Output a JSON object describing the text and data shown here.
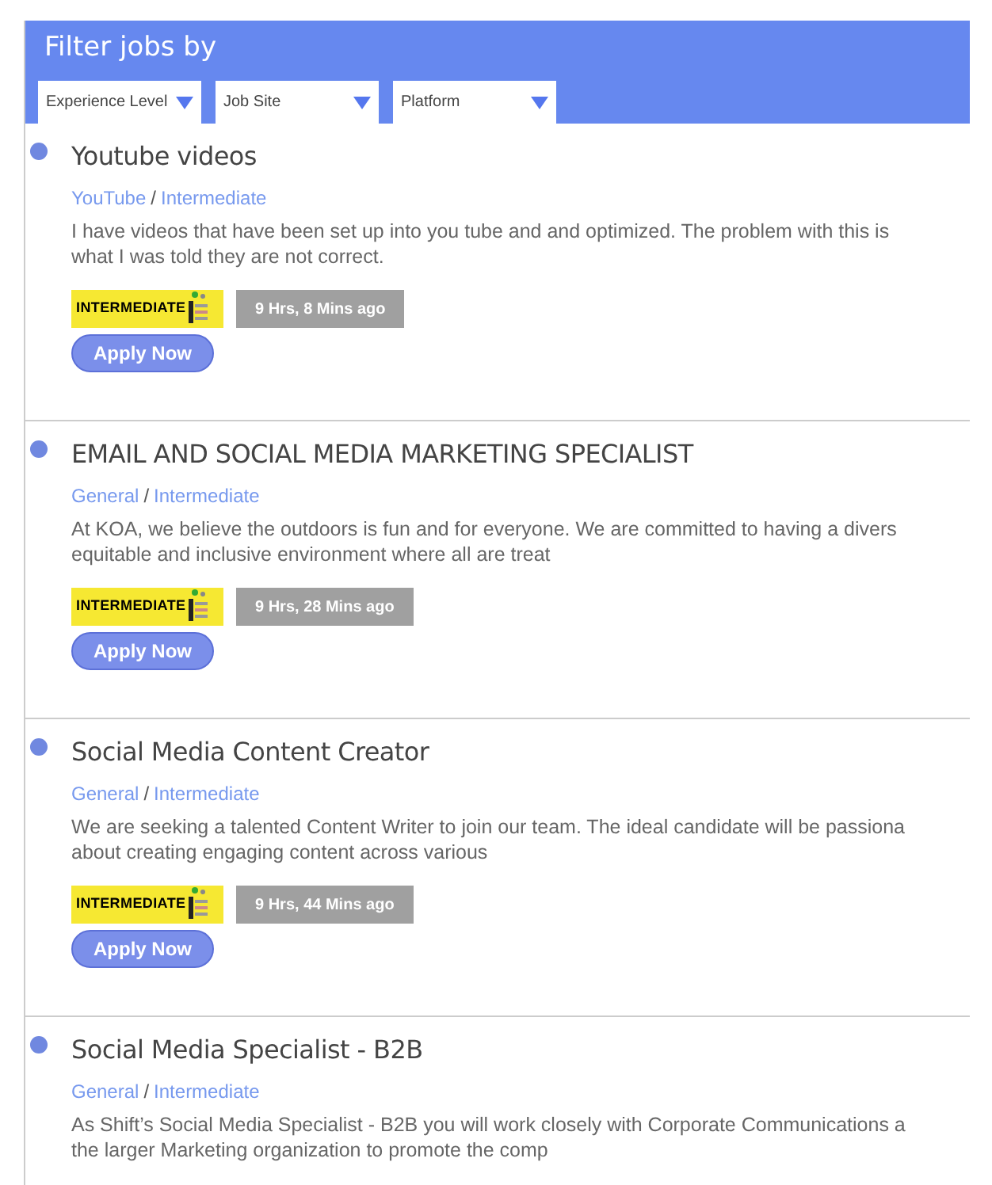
{
  "filter": {
    "title": "Filter jobs by",
    "dropdowns": [
      {
        "label": "Experience Level"
      },
      {
        "label": "Job Site"
      },
      {
        "label": "Platform"
      }
    ]
  },
  "jobs": [
    {
      "title": "Youtube videos",
      "site": "YouTube",
      "separator": "/",
      "level": "Intermediate",
      "description": [
        "I have videos that have been set up into you tube and and optimized. The problem with this is",
        "what I was told they are not correct."
      ],
      "badge": "INTERMEDIATE",
      "posted": "9 Hrs, 8 Mins ago",
      "button": "Apply Now"
    },
    {
      "title": "EMAIL AND SOCIAL MEDIA MARKETING SPECIALIST",
      "site": "General",
      "separator": "/",
      "level": "Intermediate",
      "description": [
        "At KOA, we believe the outdoors is fun and for everyone. We are committed to having a divers",
        "equitable and inclusive environment where all are treat"
      ],
      "badge": "INTERMEDIATE",
      "posted": "9 Hrs, 28 Mins ago",
      "button": "Apply Now"
    },
    {
      "title": "Social Media Content Creator",
      "site": "General",
      "separator": "/",
      "level": "Intermediate",
      "description": [
        "We are seeking a talented Content Writer to join our team. The ideal candidate will be passiona",
        "about creating engaging content across various"
      ],
      "badge": "INTERMEDIATE",
      "posted": "9 Hrs, 44 Mins ago",
      "button": "Apply Now"
    },
    {
      "title": "Social Media Specialist - B2B",
      "site": "General",
      "separator": "/",
      "level": "Intermediate",
      "description": [
        "As Shift’s Social Media Specialist - B2B you will work closely with Corporate Communications a",
        "the larger Marketing organization to promote the comp"
      ]
    }
  ]
}
